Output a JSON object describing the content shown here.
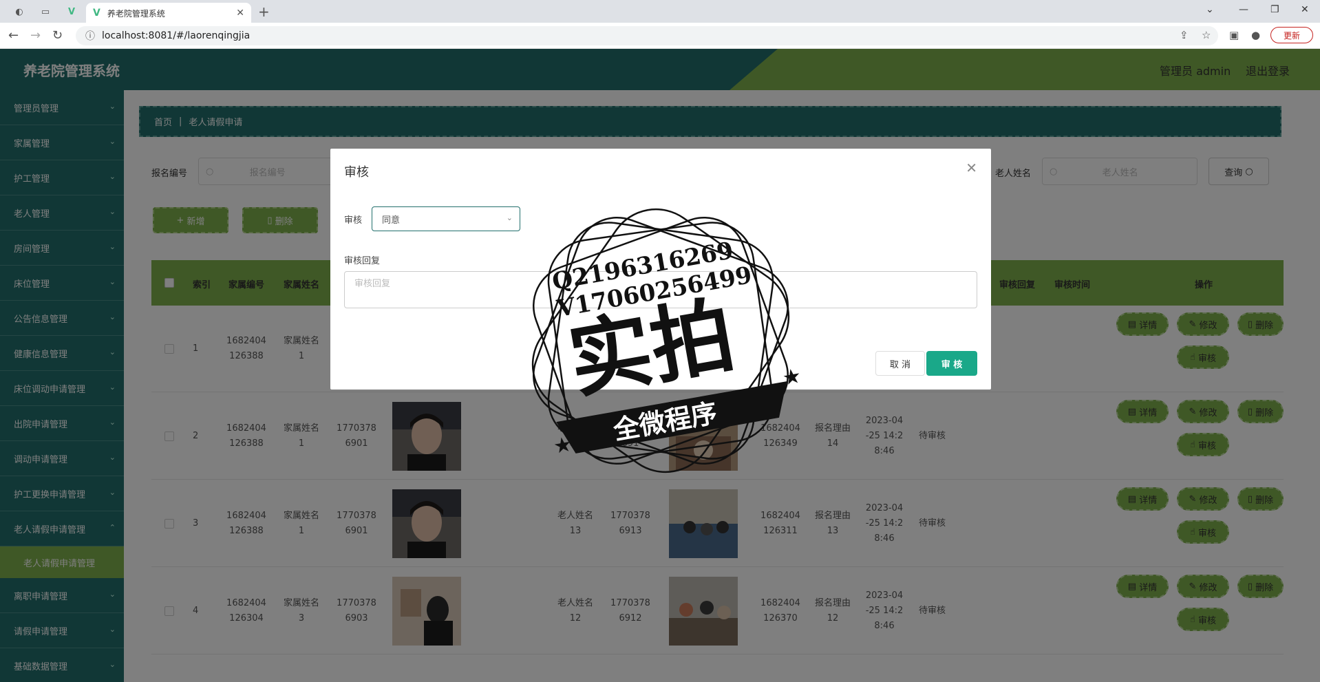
{
  "browser": {
    "tab_title": "养老院管理系统",
    "url": "localhost:8081/#/laorenqingjia",
    "update_label": "更新"
  },
  "app": {
    "brand": "养老院管理系统",
    "user_label": "管理员 admin",
    "logout_label": "退出登录"
  },
  "sidebar": {
    "items": [
      "管理员管理",
      "家属管理",
      "护工管理",
      "老人管理",
      "房间管理",
      "床位管理",
      "公告信息管理",
      "健康信息管理",
      "床位调动申请管理",
      "出院申请管理",
      "调动申请管理",
      "护工更换申请管理",
      "老人请假申请管理"
    ],
    "sub_item": "老人请假申请管理",
    "items_after": [
      "离职申请管理",
      "请假申请管理",
      "基础数据管理"
    ]
  },
  "breadcrumb": {
    "home": "首页",
    "current": "老人请假申请"
  },
  "filters": {
    "label1": "报名编号",
    "placeholder1": "报名编号",
    "label2": "老人姓名",
    "placeholder2": "老人姓名",
    "query": "查询"
  },
  "actions": {
    "add": "新增",
    "delete": "删除"
  },
  "table": {
    "headers": [
      "索引",
      "家属编号",
      "家属姓名",
      "审核回复",
      "审核时间",
      "操作"
    ],
    "rows": [
      {
        "index": "1",
        "family_no_a": "1682404",
        "family_no_b": "126388",
        "family_name_a": "家属姓名",
        "family_name_b": "1"
      },
      {
        "index": "2",
        "family_no_a": "1682404",
        "family_no_b": "126388",
        "family_name_a": "家属姓名",
        "family_name_b": "1",
        "phone_a": "1770378",
        "phone_b": "6901",
        "elder_name_a": "老人姓名",
        "elder_name_b": "14",
        "elder_phone_a": "17",
        "elder_phone_b": "691",
        "apply_no_a": "1682404",
        "apply_no_b": "126349",
        "reason_a": "报名理由",
        "reason_b": "14",
        "time_a": "2023-04",
        "time_b": "-25 14:2",
        "time_c": "8:46",
        "status": "待审核"
      },
      {
        "index": "3",
        "family_no_a": "1682404",
        "family_no_b": "126388",
        "family_name_a": "家属姓名",
        "family_name_b": "1",
        "phone_a": "1770378",
        "phone_b": "6901",
        "elder_name_a": "老人姓名",
        "elder_name_b": "13",
        "elder_phone_a": "1770378",
        "elder_phone_b": "6913",
        "apply_no_a": "1682404",
        "apply_no_b": "126311",
        "reason_a": "报名理由",
        "reason_b": "13",
        "time_a": "2023-04",
        "time_b": "-25 14:2",
        "time_c": "8:46",
        "status": "待审核"
      },
      {
        "index": "4",
        "family_no_a": "1682404",
        "family_no_b": "126304",
        "family_name_a": "家属姓名",
        "family_name_b": "3",
        "phone_a": "1770378",
        "phone_b": "6903",
        "elder_name_a": "老人姓名",
        "elder_name_b": "12",
        "elder_phone_a": "1770378",
        "elder_phone_b": "6912",
        "apply_no_a": "1682404",
        "apply_no_b": "126370",
        "reason_a": "报名理由",
        "reason_b": "12",
        "time_a": "2023-04",
        "time_b": "-25 14:2",
        "time_c": "8:46",
        "status": "待审核"
      }
    ],
    "btn_detail": "详情",
    "btn_edit": "修改",
    "btn_delete": "删除",
    "btn_review": "审核"
  },
  "dialog": {
    "title": "审核",
    "field_label": "审核",
    "select_value": "同意",
    "reply_label": "审核回复",
    "reply_placeholder": "审核回复",
    "cancel": "取 消",
    "confirm": "审 核"
  },
  "watermark": {
    "line1": "Q2196316269",
    "line2": "V17060256499",
    "main": "实拍",
    "banner": "全微程序"
  }
}
